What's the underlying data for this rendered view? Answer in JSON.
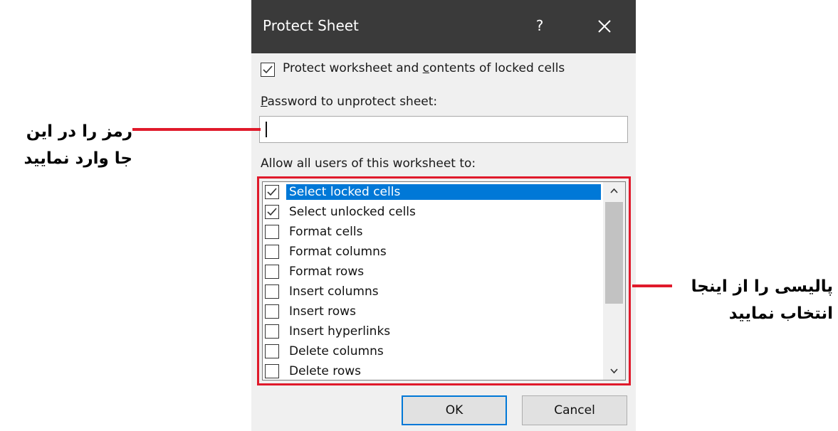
{
  "dialog": {
    "title": "Protect Sheet",
    "help_icon": "?",
    "protect_checkbox": {
      "label_pre": "Protect worksheet and ",
      "label_u": "c",
      "label_post": "ontents of locked cells",
      "checked": true
    },
    "password_label_u": "P",
    "password_label_rest": "assword to unprotect sheet:",
    "password_value": "",
    "allow_label": "Allow all users of this worksheet to:",
    "permissions": [
      {
        "label": "Select locked cells",
        "checked": true,
        "selected": true
      },
      {
        "label": "Select unlocked cells",
        "checked": true,
        "selected": false
      },
      {
        "label": "Format cells",
        "checked": false,
        "selected": false
      },
      {
        "label": "Format columns",
        "checked": false,
        "selected": false
      },
      {
        "label": "Format rows",
        "checked": false,
        "selected": false
      },
      {
        "label": "Insert columns",
        "checked": false,
        "selected": false
      },
      {
        "label": "Insert rows",
        "checked": false,
        "selected": false
      },
      {
        "label": "Insert hyperlinks",
        "checked": false,
        "selected": false
      },
      {
        "label": "Delete columns",
        "checked": false,
        "selected": false
      },
      {
        "label": "Delete rows",
        "checked": false,
        "selected": false
      }
    ],
    "ok_label": "OK",
    "cancel_label": "Cancel"
  },
  "annotations": {
    "password_note_line1": "رمز را در این",
    "password_note_line2": "جا وارد نمایید",
    "policy_note_line1": "پالیسی را از اینجا",
    "policy_note_line2": "انتخاب نمایید",
    "highlight_color": "#e01a2b"
  },
  "colors": {
    "titlebar": "#3a3a3a",
    "selection": "#0078d7",
    "dialog_bg": "#f0f0f0"
  }
}
